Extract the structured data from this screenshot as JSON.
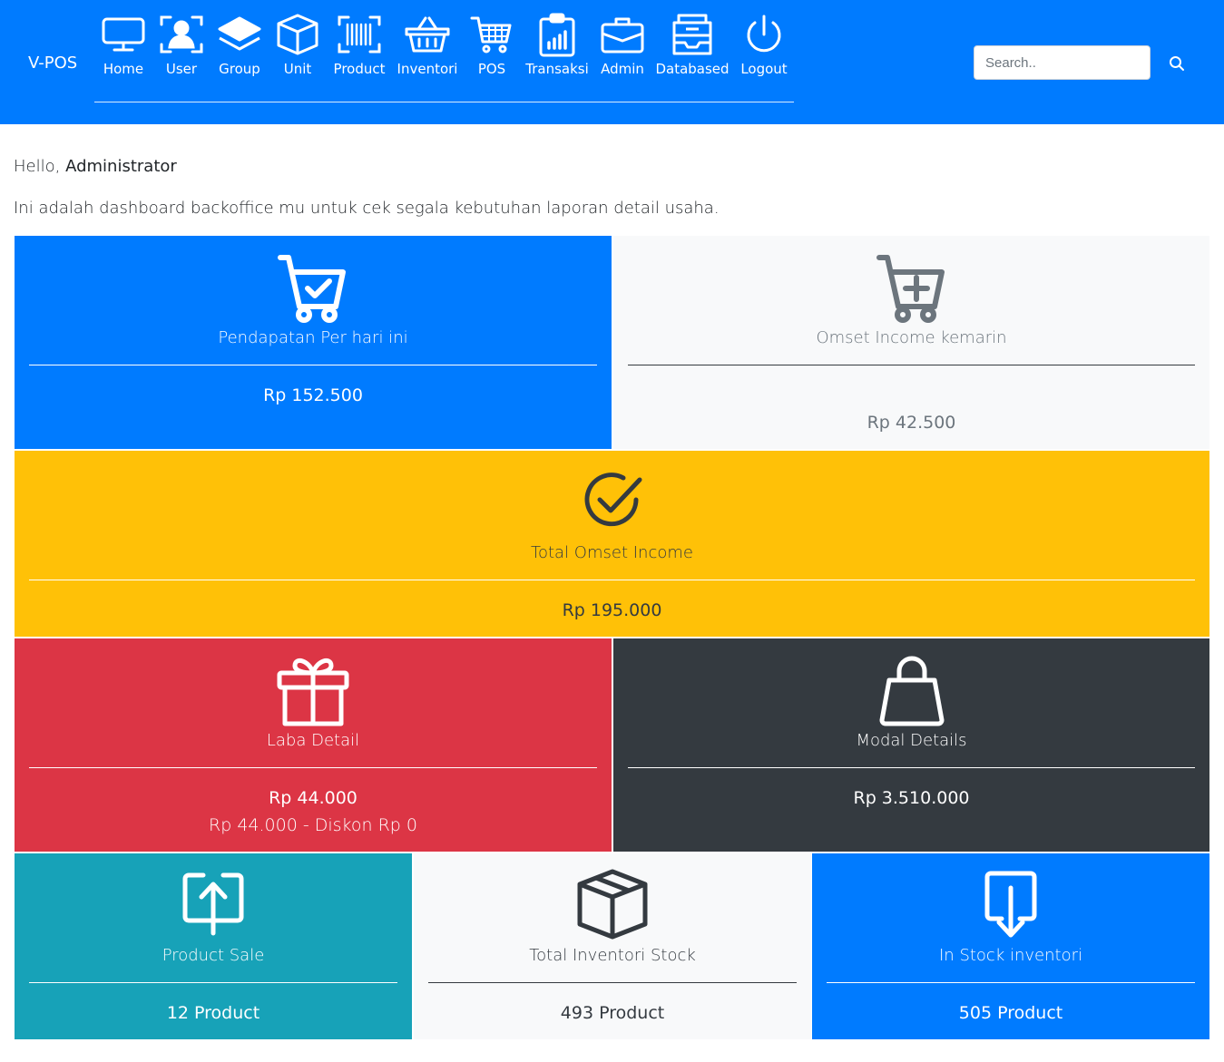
{
  "app": {
    "brand": "V-POS"
  },
  "nav": {
    "items": [
      {
        "label": "Home",
        "icon": "monitor-icon"
      },
      {
        "label": "User",
        "icon": "user-badge-icon"
      },
      {
        "label": "Group",
        "icon": "layers-icon"
      },
      {
        "label": "Unit",
        "icon": "box-icon"
      },
      {
        "label": "Product",
        "icon": "barcode-icon"
      },
      {
        "label": "Inventori",
        "icon": "basket-icon"
      },
      {
        "label": "POS",
        "icon": "cart-icon"
      },
      {
        "label": "Transaksi",
        "icon": "report-chart-icon"
      },
      {
        "label": "Admin",
        "icon": "briefcase-icon"
      },
      {
        "label": "Databased",
        "icon": "inbox-stack-icon"
      },
      {
        "label": "Logout",
        "icon": "power-icon"
      }
    ]
  },
  "search": {
    "placeholder": "Search.."
  },
  "greeting": {
    "hello": "Hello,",
    "name": "Administrator",
    "intro": "Ini adalah dashboard backoffice mu untuk cek segala kebutuhan laporan detail usaha."
  },
  "cards": {
    "today": {
      "title": "Pendapatan Per hari ini",
      "value": "Rp 152.500",
      "icon": "cart-check-icon",
      "color": "#007bff"
    },
    "yesterday": {
      "title": "Omset Income kemarin",
      "value": "Rp 42.500",
      "icon": "cart-plus-icon",
      "color": "#f8f9fa"
    },
    "total": {
      "title": "Total Omset Income",
      "value": "Rp 195.000",
      "icon": "check-circle-icon",
      "color": "#ffc107"
    },
    "laba": {
      "title": "Laba Detail",
      "value": "Rp 44.000",
      "sub": "Rp 44.000 - Diskon Rp 0",
      "icon": "gift-icon",
      "color": "#dc3545"
    },
    "modal": {
      "title": "Modal Details",
      "value": "Rp 3.510.000",
      "icon": "shopping-bag-icon",
      "color": "#343a40"
    },
    "sale": {
      "title": "Product Sale",
      "value": "12 Product",
      "icon": "box-arrow-up-icon",
      "color": "#17a2b8"
    },
    "stock": {
      "title": "Total Inventori Stock",
      "value": "493 Product",
      "icon": "box-icon",
      "color": "#f8f9fa"
    },
    "instock": {
      "title": "In Stock inventori",
      "value": "505 Product",
      "icon": "box-arrow-down-icon",
      "color": "#007bff"
    }
  }
}
